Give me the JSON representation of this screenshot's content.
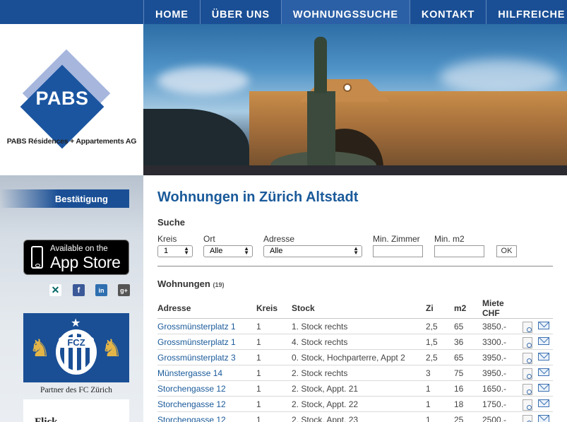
{
  "nav": {
    "items": [
      {
        "label": "HOME"
      },
      {
        "label": "ÜBER UNS"
      },
      {
        "label": "WOHNUNGSSUCHE"
      },
      {
        "label": "KONTAKT"
      },
      {
        "label": "HILFREICHE L"
      }
    ],
    "active": "WOHNUNGSSUCHE",
    "color": "#1a4f95"
  },
  "logo": {
    "text": "PABS",
    "caption": "PABS Résidences + Appartements AG"
  },
  "sidebar": {
    "confirm_label": "Bestätigung",
    "appstore": {
      "small": "Available on the",
      "big": "App Store"
    },
    "social_icons": [
      "xing-icon",
      "facebook-icon",
      "linkedin-icon",
      "googleplus-icon"
    ],
    "fcz": {
      "badge_text": "FCZ",
      "caption": "Partner des FC Zürich"
    },
    "box_text": "Flick"
  },
  "main": {
    "title": "Wohnungen in Zürich Altstadt",
    "search": {
      "title": "Suche",
      "kreis": {
        "label": "Kreis",
        "value": "1"
      },
      "ort": {
        "label": "Ort",
        "value": "Alle"
      },
      "adresse": {
        "label": "Adresse",
        "value": "Alle"
      },
      "min_zimmer": {
        "label": "Min. Zimmer",
        "value": ""
      },
      "min_m2": {
        "label": "Min. m2",
        "value": ""
      },
      "ok_label": "OK"
    },
    "results": {
      "title": "Wohnungen",
      "count": "(19)",
      "columns": [
        "Adresse",
        "Kreis",
        "Stock",
        "Zi",
        "m2",
        "Miete CHF"
      ],
      "rows": [
        [
          "Grossmünsterplatz 1",
          "1",
          "1. Stock rechts",
          "2,5",
          "65",
          "3850.-"
        ],
        [
          "Grossmünsterplatz 1",
          "1",
          "4. Stock rechts",
          "1,5",
          "36",
          "3300.-"
        ],
        [
          "Grossmünsterplatz 3",
          "1",
          "0. Stock, Hochparterre, Appt 2",
          "2,5",
          "65",
          "3950.-"
        ],
        [
          "Münstergasse 14",
          "1",
          "2. Stock rechts",
          "3",
          "75",
          "3950.-"
        ],
        [
          "Storchengasse 12",
          "1",
          "2. Stock, Appt. 21",
          "1",
          "16",
          "1650.-"
        ],
        [
          "Storchengasse 12",
          "1",
          "2. Stock, Appt. 22",
          "1",
          "18",
          "1750.-"
        ],
        [
          "Storchengasse 12",
          "1",
          "2. Stock, Appt. 23",
          "1",
          "25",
          "2500.-"
        ]
      ]
    }
  }
}
